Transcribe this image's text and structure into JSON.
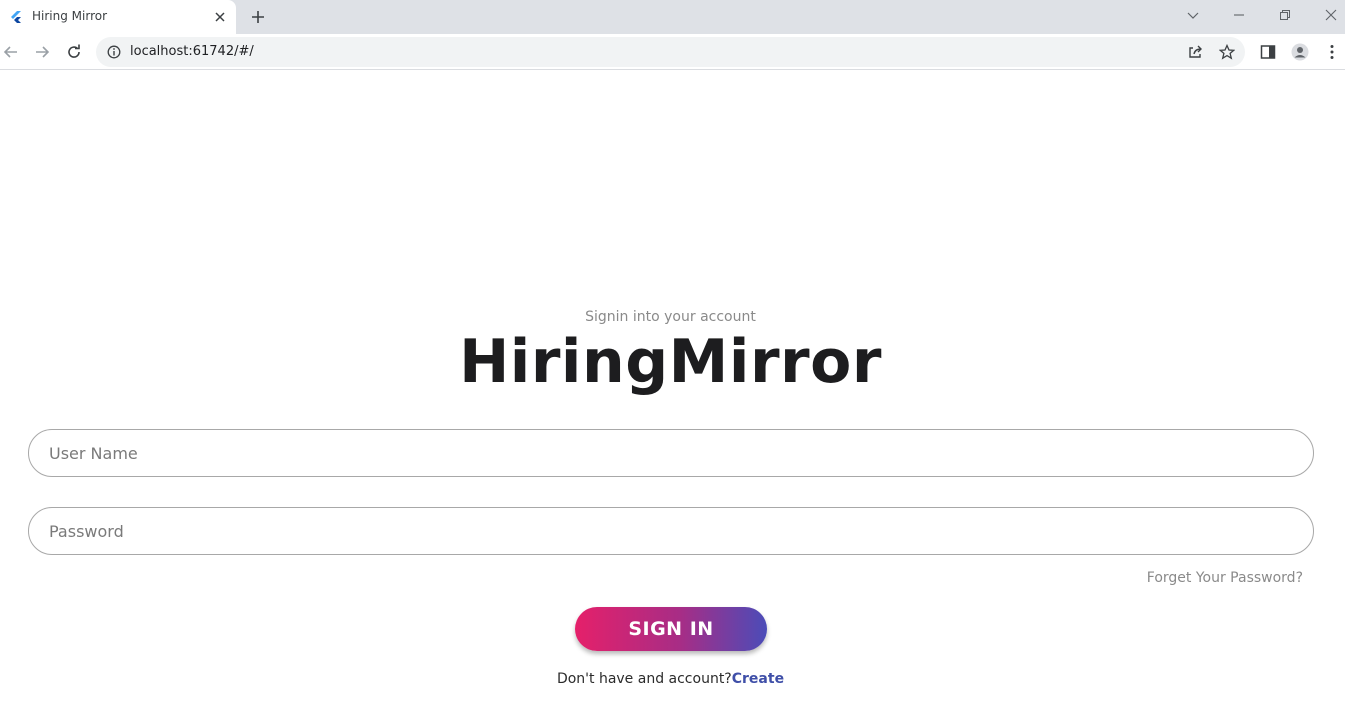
{
  "browser": {
    "tab_title": "Hiring Mirror",
    "url": "localhost:61742/#/"
  },
  "login": {
    "subtitle": "Signin into your account",
    "brand": "HiringMirror",
    "username_placeholder": "User Name",
    "password_placeholder": "Password",
    "forgot_label": "Forget Your Password?",
    "signin_label": "SIGN IN",
    "no_account_text": "Don't have and account?",
    "create_label": "Create"
  },
  "colors": {
    "gradient_start": "#e5206a",
    "gradient_end": "#4b4cb8",
    "link": "#3f4fa8"
  },
  "icons": [
    "flutter-icon",
    "close-icon",
    "plus-icon",
    "chevron-down-icon",
    "minimize-icon",
    "restore-icon",
    "window-close-icon",
    "back-icon",
    "forward-icon",
    "reload-icon",
    "info-icon",
    "share-icon",
    "star-icon",
    "side-panel-icon",
    "profile-icon",
    "menu-icon"
  ]
}
